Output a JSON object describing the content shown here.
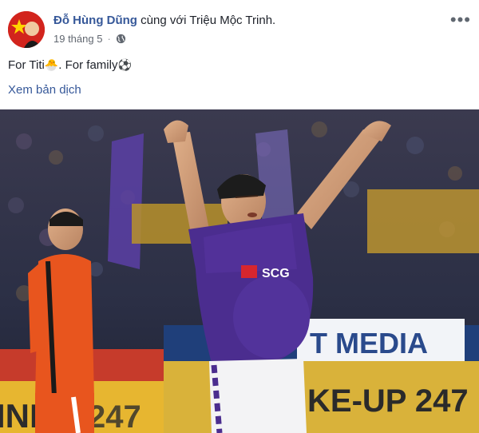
{
  "post": {
    "author": "Đỗ Hùng Dũng",
    "with_text": "cùng với Triệu Mộc Trinh.",
    "date": "19 tháng 5",
    "separator": "·",
    "privacy_icon": "globe-icon",
    "more_icon": "more-options-icon",
    "more_label": "•••",
    "text_part1": "For Titi",
    "emoji1": "🐣",
    "text_part2": ". For family",
    "emoji2": "⚽",
    "translate_link": "Xem bản dịch"
  },
  "photo": {
    "description_icon": "football-celebration-photo",
    "jersey_sponsor": "SCG",
    "banner_text_1": "T MEDIA",
    "banner_text_2": "KE-UP 247",
    "banner_text_3": "INE",
    "banner_text_4": "247"
  },
  "colors": {
    "link": "#365899",
    "text": "#1d2129",
    "meta": "#616770",
    "jersey_purple": "#4b2d8f",
    "opponent_orange": "#e8551e"
  }
}
